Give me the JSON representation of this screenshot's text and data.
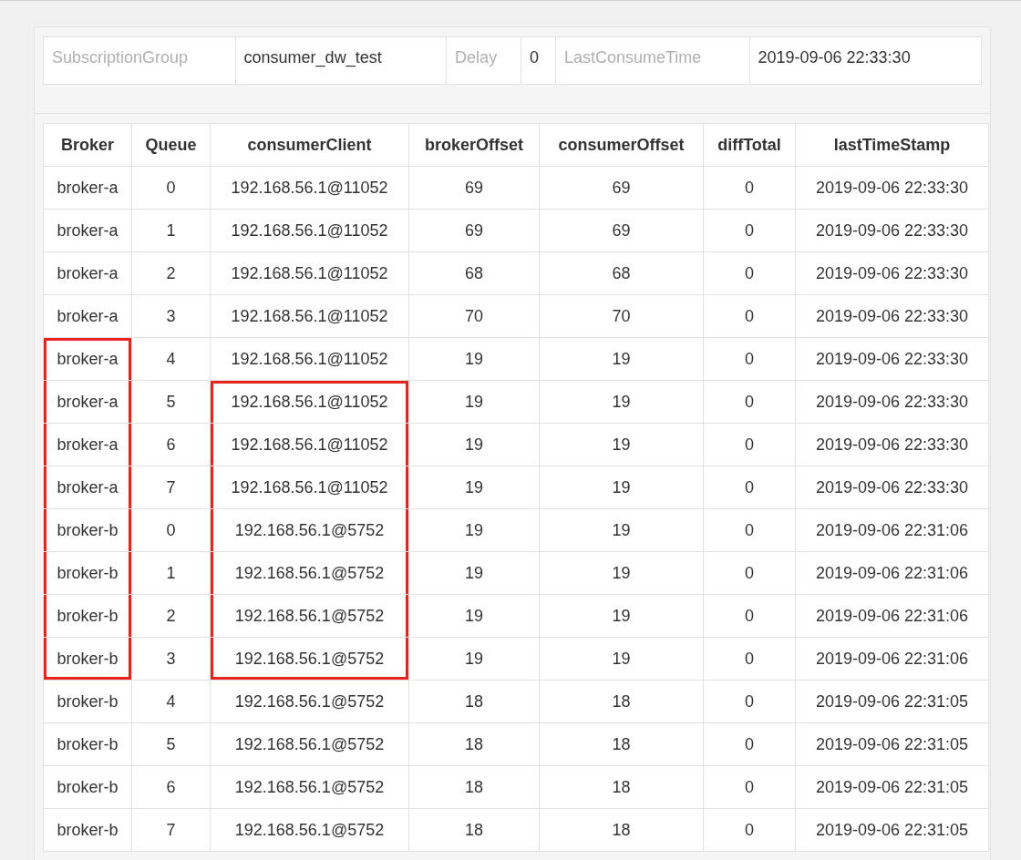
{
  "summary": [
    {
      "label": "SubscriptionGroup",
      "value": "consumer_dw_test"
    },
    {
      "label": "Delay",
      "value": "0"
    },
    {
      "label": "LastConsumeTime",
      "value": "2019-09-06 22:33:30"
    }
  ],
  "table": {
    "columns": [
      "Broker",
      "Queue",
      "consumerClient",
      "brokerOffset",
      "consumerOffset",
      "diffTotal",
      "lastTimeStamp"
    ],
    "rows": [
      {
        "cells": [
          "broker-a",
          "0",
          "192.168.56.1@11052",
          "69",
          "69",
          "0",
          "2019-09-06 22:33:30"
        ],
        "marked_broker": false,
        "marked_client": false
      },
      {
        "cells": [
          "broker-a",
          "1",
          "192.168.56.1@11052",
          "69",
          "69",
          "0",
          "2019-09-06 22:33:30"
        ],
        "marked_broker": false,
        "marked_client": false
      },
      {
        "cells": [
          "broker-a",
          "2",
          "192.168.56.1@11052",
          "68",
          "68",
          "0",
          "2019-09-06 22:33:30"
        ],
        "marked_broker": false,
        "marked_client": false
      },
      {
        "cells": [
          "broker-a",
          "3",
          "192.168.56.1@11052",
          "70",
          "70",
          "0",
          "2019-09-06 22:33:30"
        ],
        "marked_broker": false,
        "marked_client": false
      },
      {
        "cells": [
          "broker-a",
          "4",
          "192.168.56.1@11052",
          "19",
          "19",
          "0",
          "2019-09-06 22:33:30"
        ],
        "marked_broker": true,
        "marked_client": false
      },
      {
        "cells": [
          "broker-a",
          "5",
          "192.168.56.1@11052",
          "19",
          "19",
          "0",
          "2019-09-06 22:33:30"
        ],
        "marked_broker": true,
        "marked_client": true
      },
      {
        "cells": [
          "broker-a",
          "6",
          "192.168.56.1@11052",
          "19",
          "19",
          "0",
          "2019-09-06 22:33:30"
        ],
        "marked_broker": true,
        "marked_client": true
      },
      {
        "cells": [
          "broker-a",
          "7",
          "192.168.56.1@11052",
          "19",
          "19",
          "0",
          "2019-09-06 22:33:30"
        ],
        "marked_broker": true,
        "marked_client": true
      },
      {
        "cells": [
          "broker-b",
          "0",
          "192.168.56.1@5752",
          "19",
          "19",
          "0",
          "2019-09-06 22:31:06"
        ],
        "marked_broker": true,
        "marked_client": true
      },
      {
        "cells": [
          "broker-b",
          "1",
          "192.168.56.1@5752",
          "19",
          "19",
          "0",
          "2019-09-06 22:31:06"
        ],
        "marked_broker": true,
        "marked_client": true
      },
      {
        "cells": [
          "broker-b",
          "2",
          "192.168.56.1@5752",
          "19",
          "19",
          "0",
          "2019-09-06 22:31:06"
        ],
        "marked_broker": true,
        "marked_client": true
      },
      {
        "cells": [
          "broker-b",
          "3",
          "192.168.56.1@5752",
          "19",
          "19",
          "0",
          "2019-09-06 22:31:06"
        ],
        "marked_broker": true,
        "marked_client": true
      },
      {
        "cells": [
          "broker-b",
          "4",
          "192.168.56.1@5752",
          "18",
          "18",
          "0",
          "2019-09-06 22:31:05"
        ],
        "marked_broker": false,
        "marked_client": false
      },
      {
        "cells": [
          "broker-b",
          "5",
          "192.168.56.1@5752",
          "18",
          "18",
          "0",
          "2019-09-06 22:31:05"
        ],
        "marked_broker": false,
        "marked_client": false
      },
      {
        "cells": [
          "broker-b",
          "6",
          "192.168.56.1@5752",
          "18",
          "18",
          "0",
          "2019-09-06 22:31:05"
        ],
        "marked_broker": false,
        "marked_client": false
      },
      {
        "cells": [
          "broker-b",
          "7",
          "192.168.56.1@5752",
          "18",
          "18",
          "0",
          "2019-09-06 22:31:05"
        ],
        "marked_broker": false,
        "marked_client": false
      }
    ]
  }
}
